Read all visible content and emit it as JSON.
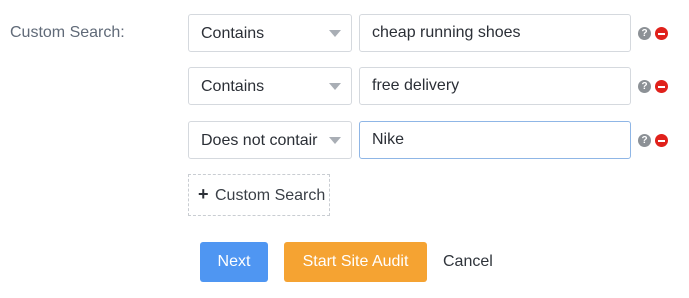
{
  "custom_search": {
    "label": "Custom Search:",
    "rules": [
      {
        "condition": "Contains",
        "value": "cheap running shoes"
      },
      {
        "condition": "Contains",
        "value": "free delivery"
      },
      {
        "condition": "Does not contair",
        "value": "Nike"
      }
    ],
    "help_glyph": "?",
    "add_button_label": "Custom Search",
    "add_glyph": "+"
  },
  "actions": {
    "next_label": "Next",
    "start_audit_label": "Start Site Audit",
    "cancel_label": "Cancel"
  },
  "icons": {
    "help": "question-circle-icon",
    "remove": "minus-circle-icon",
    "caret": "caret-down-icon",
    "add": "plus-icon"
  },
  "colors": {
    "primary": "#4f96f2",
    "accent": "#f5a332",
    "danger": "#e0211b",
    "focus_border": "#8fb6e6"
  }
}
